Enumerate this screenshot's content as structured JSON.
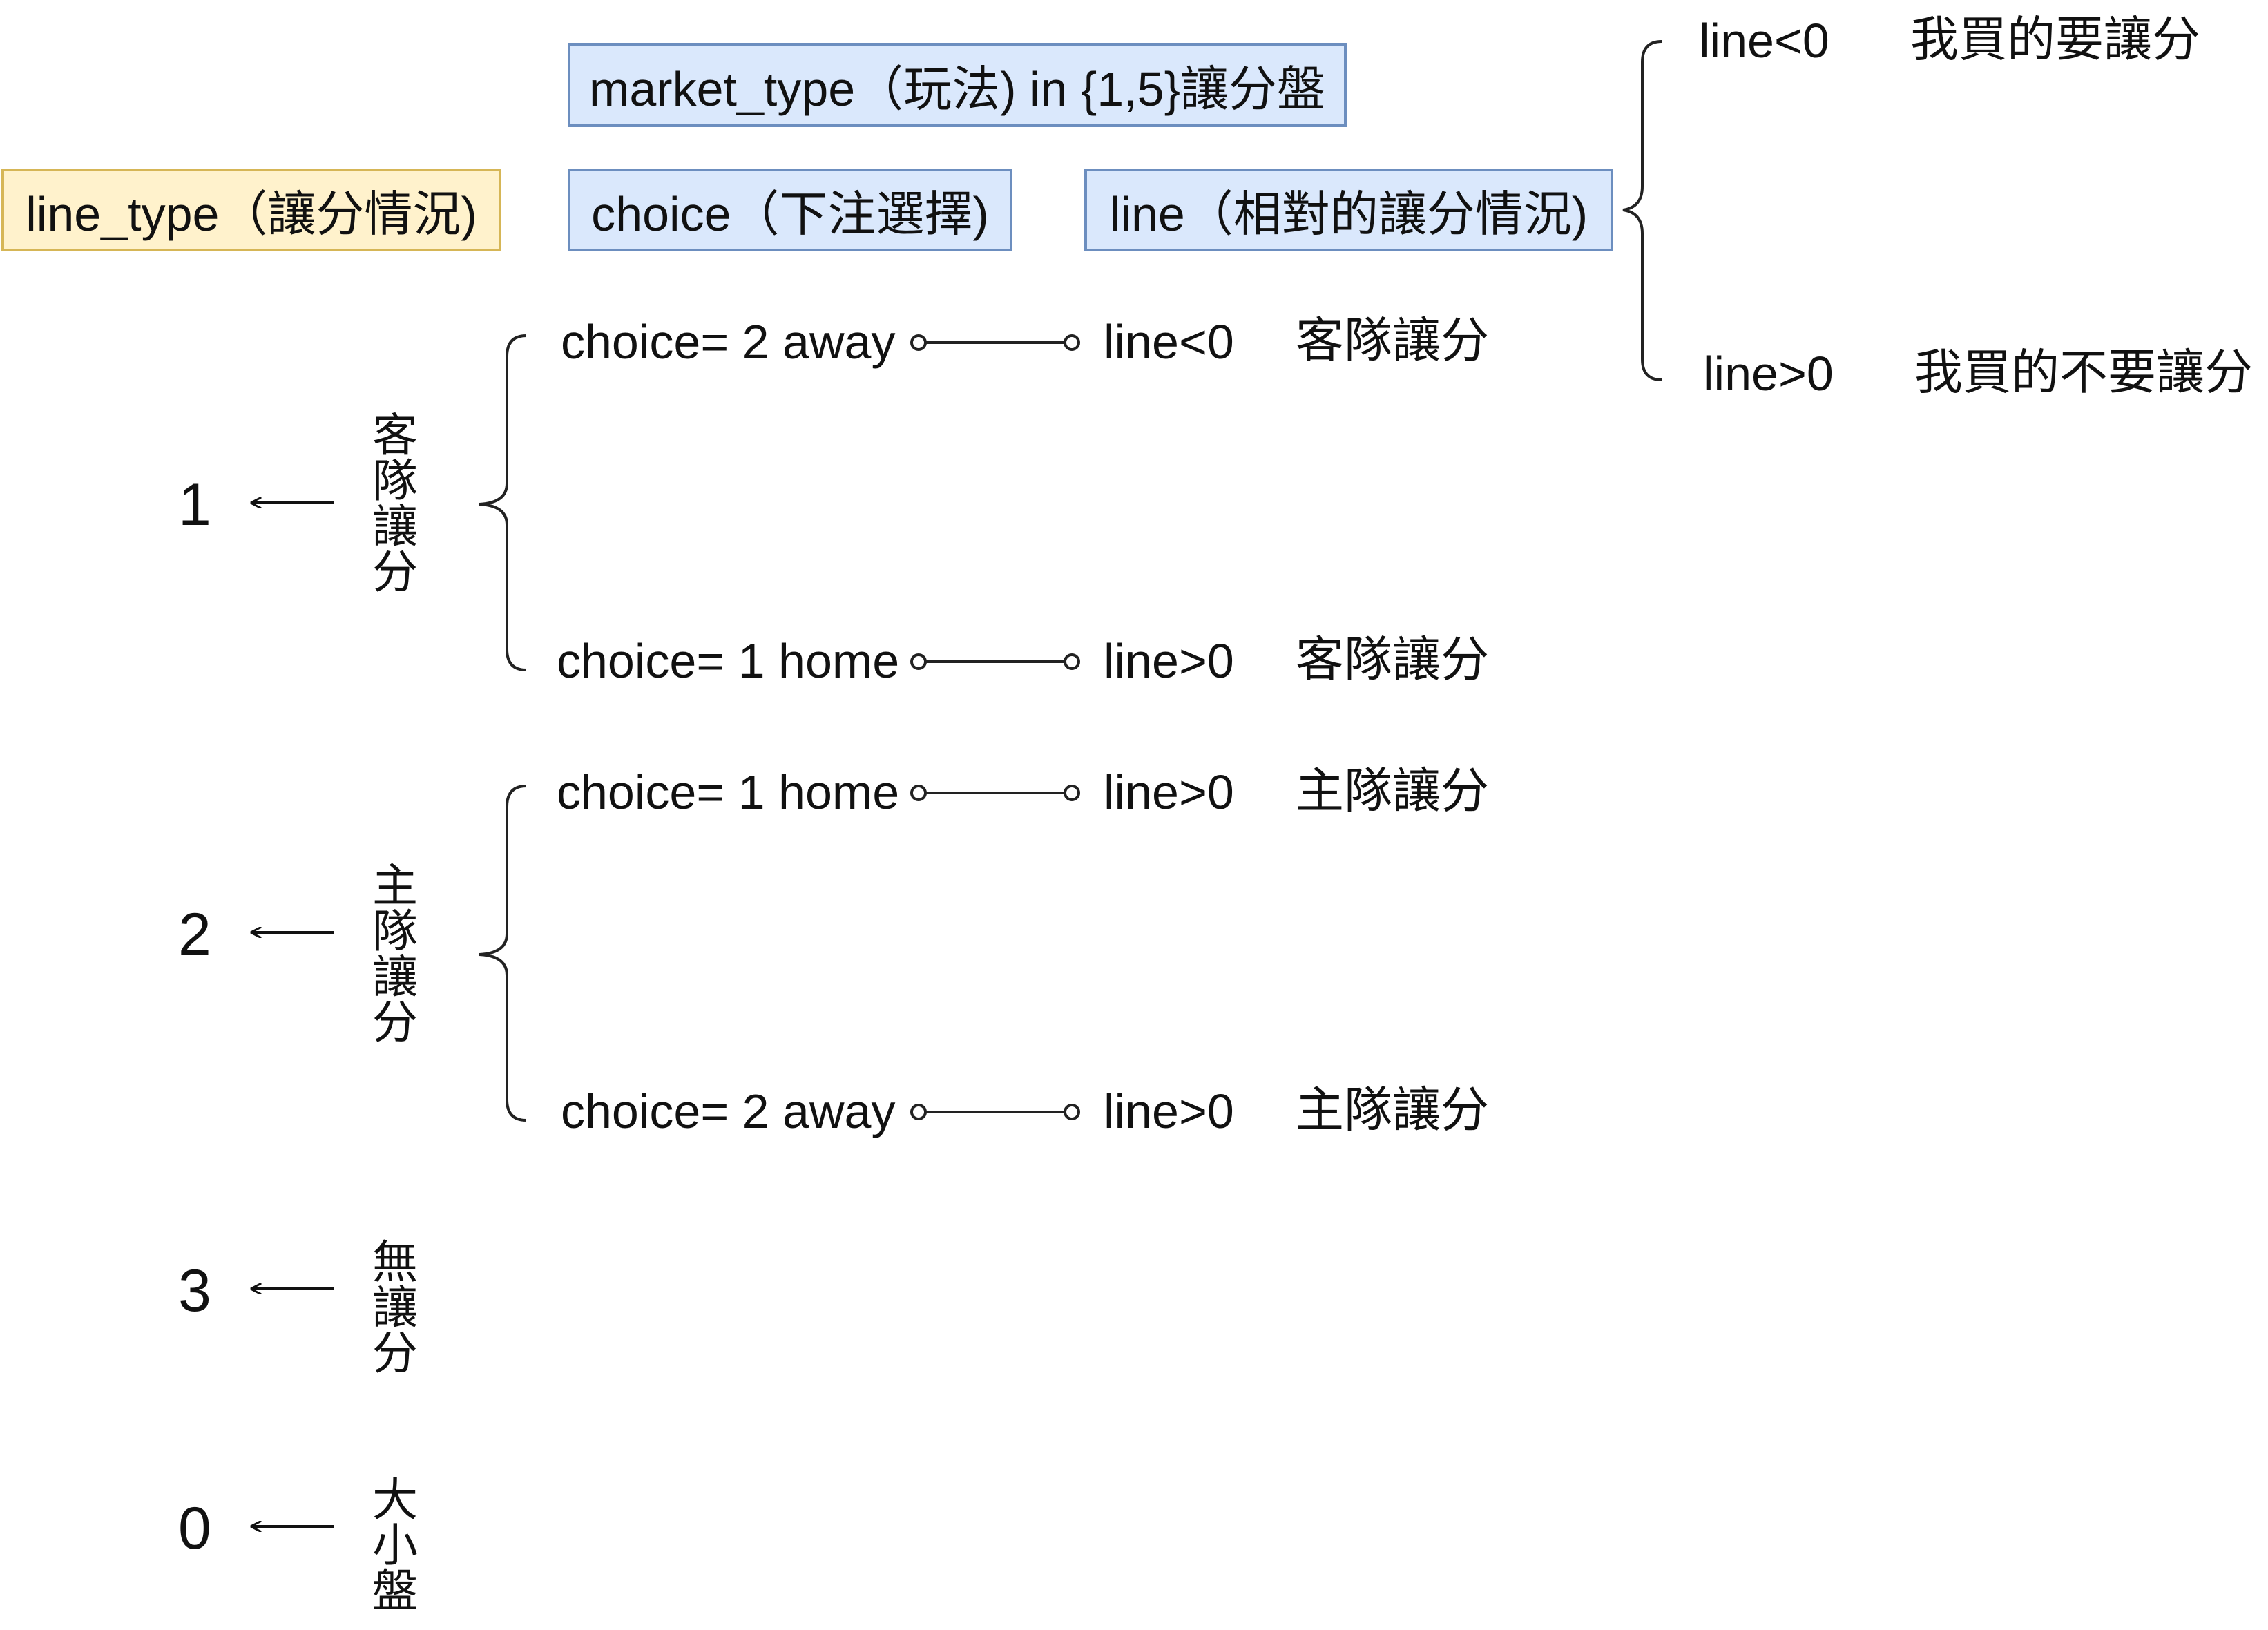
{
  "headers": {
    "market_type": "market_type（玩法) in {1,5}讓分盤",
    "line_type": "line_type（讓分情況)",
    "choice": "choice（下注選擇)",
    "line": "line（相對的讓分情況)"
  },
  "top_right": [
    {
      "line": "line<0",
      "meaning": "我買的要讓分"
    },
    {
      "line": "line>0",
      "meaning": "我買的不要讓分"
    }
  ],
  "groups": [
    {
      "value": "1",
      "label": "客隊讓分",
      "rows": [
        {
          "choice": "choice= 2 away",
          "line": "line<0",
          "note": "客隊讓分"
        },
        {
          "choice": "choice= 1 home",
          "line": "line>0",
          "note": "客隊讓分"
        }
      ]
    },
    {
      "value": "2",
      "label": "主隊讓分",
      "rows": [
        {
          "choice": "choice= 1 home",
          "line": "line>0",
          "note": "主隊讓分"
        },
        {
          "choice": "choice= 2 away",
          "line": "line>0",
          "note": "主隊讓分"
        }
      ]
    },
    {
      "value": "3",
      "label": "無讓分",
      "rows": []
    },
    {
      "value": "0",
      "label": "大小盤",
      "rows": []
    }
  ]
}
